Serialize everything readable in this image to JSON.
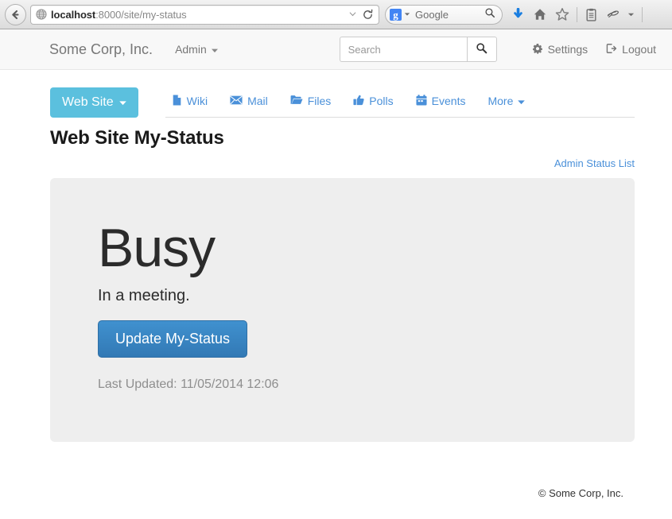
{
  "browser": {
    "back_icon": "back-arrow-icon",
    "favicon": "globe-icon",
    "url_host": "localhost",
    "url_rest": ":8000/site/my-status",
    "url_dropdown_icon": "chevron-down-icon",
    "reload_icon": "reload-icon",
    "search_engine_logo": "g",
    "search_engine_label": "Google",
    "search_engine_caret_icon": "chevron-down-icon",
    "search_magnifier_icon": "search-icon",
    "toolbar_icons": [
      "download-arrow-icon",
      "home-icon",
      "star-icon",
      "reading-list-icon",
      "sync-icon",
      "chevron-down-icon",
      "hamburger-menu-icon"
    ]
  },
  "navbar": {
    "brand": "Some Corp, Inc.",
    "admin_label": "Admin",
    "admin_caret_icon": "caret-down-icon",
    "search_placeholder": "Search",
    "search_value": "",
    "search_button_icon": "search-icon",
    "settings_label": "Settings",
    "settings_icon": "gear-icon",
    "logout_label": "Logout",
    "logout_icon": "logout-icon"
  },
  "group_nav": {
    "group_button_label": "Web Site",
    "group_button_caret_icon": "caret-down-icon",
    "group_button_color": "#5bc0de",
    "tabs": [
      {
        "label": "Wiki",
        "icon": "file-icon"
      },
      {
        "label": "Mail",
        "icon": "envelope-icon"
      },
      {
        "label": "Files",
        "icon": "folder-open-icon"
      },
      {
        "label": "Polls",
        "icon": "thumbs-up-icon"
      },
      {
        "label": "Events",
        "icon": "calendar-icon"
      },
      {
        "label": "More",
        "icon": "caret-down-icon"
      }
    ],
    "tab_link_color": "#4a90d9"
  },
  "main": {
    "page_title": "Web Site My-Status",
    "admin_status_list_label": "Admin Status List",
    "panel_background": "#eeeeee",
    "status_name": "Busy",
    "status_message": "In a meeting.",
    "update_button_label": "Update My-Status",
    "update_button_color": "#3279b5",
    "last_updated": "Last Updated: 11/05/2014 12:06"
  },
  "footer": {
    "copyright": "© Some Corp, Inc."
  }
}
